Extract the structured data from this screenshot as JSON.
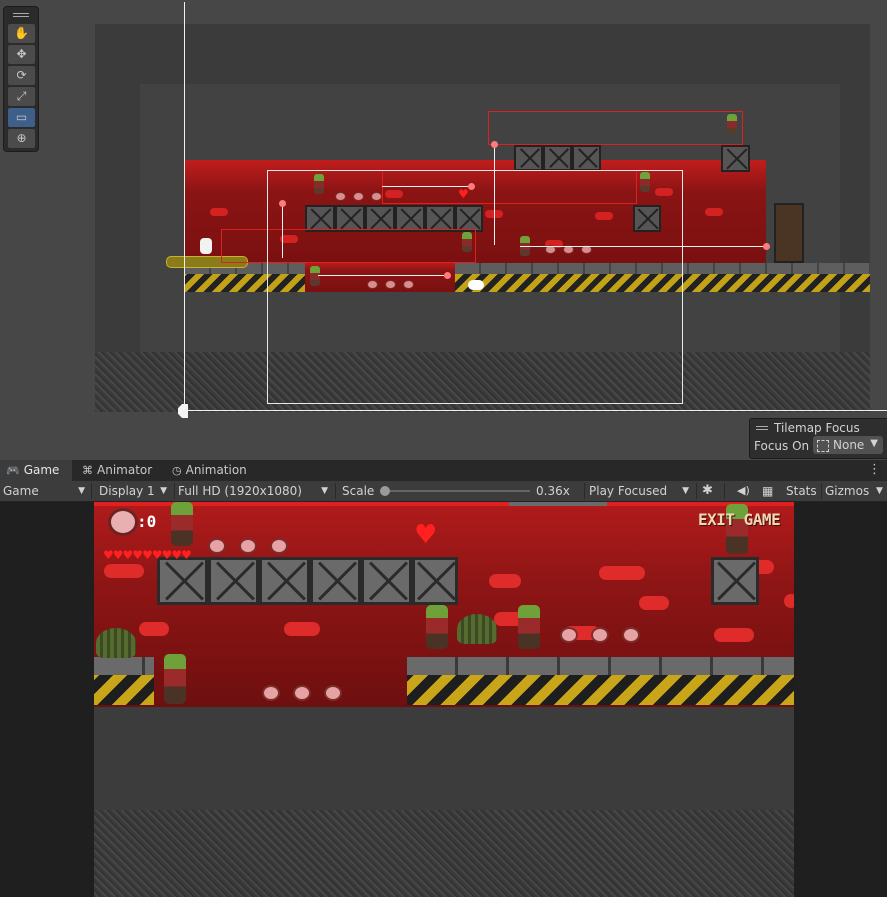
{
  "scene": {
    "tools": [
      {
        "icon": "hand-tool-icon",
        "glyph": "✋"
      },
      {
        "icon": "move-tool-icon",
        "glyph": "✥"
      },
      {
        "icon": "rotate-tool-icon",
        "glyph": "⟳"
      },
      {
        "icon": "scale-tool-icon",
        "glyph": "⤢"
      },
      {
        "icon": "rect-tool-icon",
        "glyph": "▭"
      },
      {
        "icon": "transform-tool-icon",
        "glyph": "⊕"
      }
    ],
    "active_tool_index": 4,
    "tilemap_focus": {
      "title": "Tilemap Focus",
      "label": "Focus On",
      "value": "None"
    }
  },
  "tabs": [
    {
      "label": "Game",
      "icon": "gamepad-icon",
      "glyph": "🎮",
      "active": true
    },
    {
      "label": "Animator",
      "icon": "animator-icon",
      "glyph": "⌘",
      "active": false
    },
    {
      "label": "Animation",
      "icon": "clock-icon",
      "glyph": "◷",
      "active": false
    }
  ],
  "game_toolbar": {
    "view_select": "Game",
    "display_select": "Display 1",
    "resolution_select": "Full HD (1920x1080)",
    "scale_label": "Scale",
    "scale_value": "0.36x",
    "play_mode_select": "Play Focused",
    "stats_label": "Stats",
    "gizmos_label": "Gizmos"
  },
  "game": {
    "meat_count": ":0",
    "hearts": [
      "♥",
      "♥",
      "♥",
      "♥",
      "♥",
      "♥",
      "♥",
      "♥",
      "♥"
    ],
    "exit_label": "EXIT GAME",
    "colors": {
      "sky_red": "#b11b1b",
      "cloud_red": "#e02b2b",
      "hazard_yellow": "#c9a51a",
      "exit_text": "#f3d7b0"
    }
  }
}
